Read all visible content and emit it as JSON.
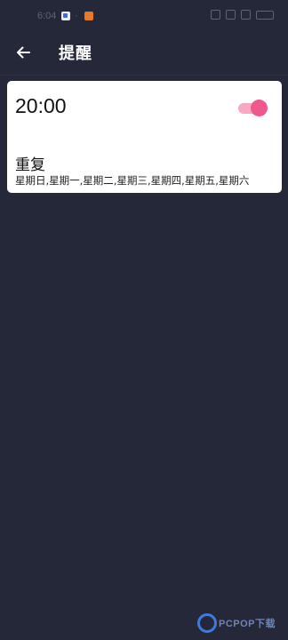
{
  "status_bar": {
    "time": "6:04",
    "separator": "·"
  },
  "header": {
    "title": "提醒"
  },
  "reminder": {
    "time": "20:00",
    "enabled": true,
    "repeat_label": "重复",
    "repeat_days": "星期日,星期一,星期二,星期三,星期四,星期五,星期六"
  },
  "watermark": {
    "text": "PCPOP下载"
  },
  "colors": {
    "background": "#242838",
    "card": "#ffffff",
    "toggle_thumb": "#f0588d",
    "toggle_track": "#f7a9c4"
  }
}
